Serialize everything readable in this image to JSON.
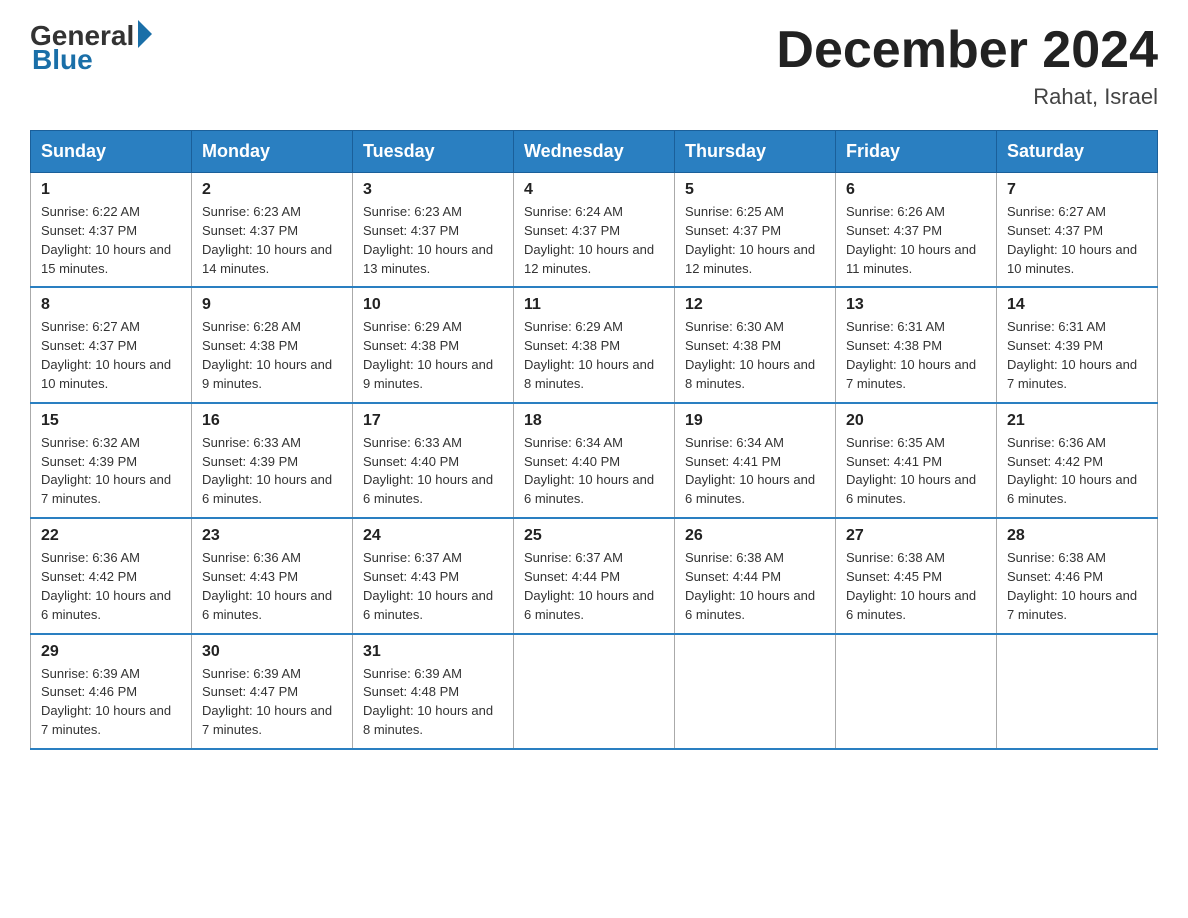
{
  "header": {
    "logo_general": "General",
    "logo_blue": "Blue",
    "month_title": "December 2024",
    "location": "Rahat, Israel"
  },
  "weekdays": [
    "Sunday",
    "Monday",
    "Tuesday",
    "Wednesday",
    "Thursday",
    "Friday",
    "Saturday"
  ],
  "weeks": [
    [
      {
        "day": "1",
        "sunrise": "6:22 AM",
        "sunset": "4:37 PM",
        "daylight": "10 hours and 15 minutes."
      },
      {
        "day": "2",
        "sunrise": "6:23 AM",
        "sunset": "4:37 PM",
        "daylight": "10 hours and 14 minutes."
      },
      {
        "day": "3",
        "sunrise": "6:23 AM",
        "sunset": "4:37 PM",
        "daylight": "10 hours and 13 minutes."
      },
      {
        "day": "4",
        "sunrise": "6:24 AM",
        "sunset": "4:37 PM",
        "daylight": "10 hours and 12 minutes."
      },
      {
        "day": "5",
        "sunrise": "6:25 AM",
        "sunset": "4:37 PM",
        "daylight": "10 hours and 12 minutes."
      },
      {
        "day": "6",
        "sunrise": "6:26 AM",
        "sunset": "4:37 PM",
        "daylight": "10 hours and 11 minutes."
      },
      {
        "day": "7",
        "sunrise": "6:27 AM",
        "sunset": "4:37 PM",
        "daylight": "10 hours and 10 minutes."
      }
    ],
    [
      {
        "day": "8",
        "sunrise": "6:27 AM",
        "sunset": "4:37 PM",
        "daylight": "10 hours and 10 minutes."
      },
      {
        "day": "9",
        "sunrise": "6:28 AM",
        "sunset": "4:38 PM",
        "daylight": "10 hours and 9 minutes."
      },
      {
        "day": "10",
        "sunrise": "6:29 AM",
        "sunset": "4:38 PM",
        "daylight": "10 hours and 9 minutes."
      },
      {
        "day": "11",
        "sunrise": "6:29 AM",
        "sunset": "4:38 PM",
        "daylight": "10 hours and 8 minutes."
      },
      {
        "day": "12",
        "sunrise": "6:30 AM",
        "sunset": "4:38 PM",
        "daylight": "10 hours and 8 minutes."
      },
      {
        "day": "13",
        "sunrise": "6:31 AM",
        "sunset": "4:38 PM",
        "daylight": "10 hours and 7 minutes."
      },
      {
        "day": "14",
        "sunrise": "6:31 AM",
        "sunset": "4:39 PM",
        "daylight": "10 hours and 7 minutes."
      }
    ],
    [
      {
        "day": "15",
        "sunrise": "6:32 AM",
        "sunset": "4:39 PM",
        "daylight": "10 hours and 7 minutes."
      },
      {
        "day": "16",
        "sunrise": "6:33 AM",
        "sunset": "4:39 PM",
        "daylight": "10 hours and 6 minutes."
      },
      {
        "day": "17",
        "sunrise": "6:33 AM",
        "sunset": "4:40 PM",
        "daylight": "10 hours and 6 minutes."
      },
      {
        "day": "18",
        "sunrise": "6:34 AM",
        "sunset": "4:40 PM",
        "daylight": "10 hours and 6 minutes."
      },
      {
        "day": "19",
        "sunrise": "6:34 AM",
        "sunset": "4:41 PM",
        "daylight": "10 hours and 6 minutes."
      },
      {
        "day": "20",
        "sunrise": "6:35 AM",
        "sunset": "4:41 PM",
        "daylight": "10 hours and 6 minutes."
      },
      {
        "day": "21",
        "sunrise": "6:36 AM",
        "sunset": "4:42 PM",
        "daylight": "10 hours and 6 minutes."
      }
    ],
    [
      {
        "day": "22",
        "sunrise": "6:36 AM",
        "sunset": "4:42 PM",
        "daylight": "10 hours and 6 minutes."
      },
      {
        "day": "23",
        "sunrise": "6:36 AM",
        "sunset": "4:43 PM",
        "daylight": "10 hours and 6 minutes."
      },
      {
        "day": "24",
        "sunrise": "6:37 AM",
        "sunset": "4:43 PM",
        "daylight": "10 hours and 6 minutes."
      },
      {
        "day": "25",
        "sunrise": "6:37 AM",
        "sunset": "4:44 PM",
        "daylight": "10 hours and 6 minutes."
      },
      {
        "day": "26",
        "sunrise": "6:38 AM",
        "sunset": "4:44 PM",
        "daylight": "10 hours and 6 minutes."
      },
      {
        "day": "27",
        "sunrise": "6:38 AM",
        "sunset": "4:45 PM",
        "daylight": "10 hours and 6 minutes."
      },
      {
        "day": "28",
        "sunrise": "6:38 AM",
        "sunset": "4:46 PM",
        "daylight": "10 hours and 7 minutes."
      }
    ],
    [
      {
        "day": "29",
        "sunrise": "6:39 AM",
        "sunset": "4:46 PM",
        "daylight": "10 hours and 7 minutes."
      },
      {
        "day": "30",
        "sunrise": "6:39 AM",
        "sunset": "4:47 PM",
        "daylight": "10 hours and 7 minutes."
      },
      {
        "day": "31",
        "sunrise": "6:39 AM",
        "sunset": "4:48 PM",
        "daylight": "10 hours and 8 minutes."
      },
      null,
      null,
      null,
      null
    ]
  ]
}
